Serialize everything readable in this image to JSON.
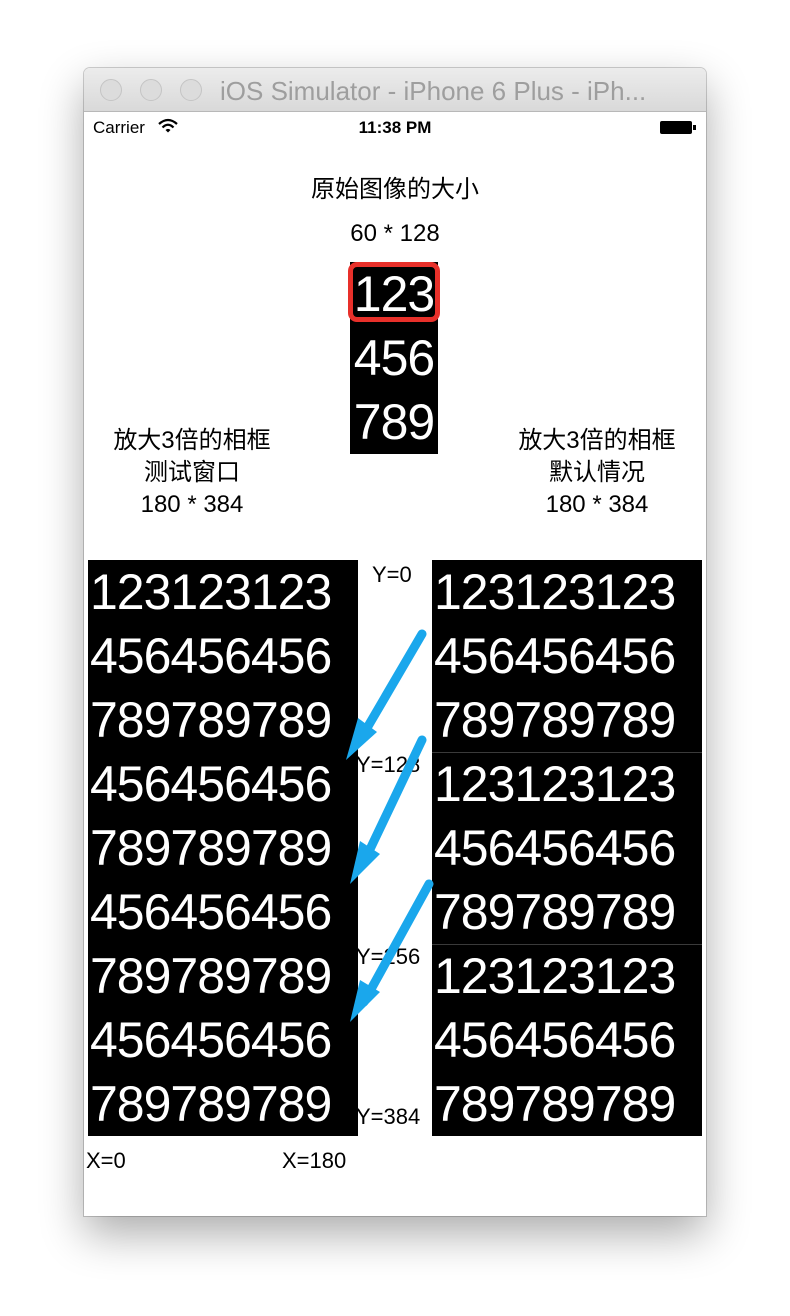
{
  "window": {
    "title": "iOS Simulator - iPhone 6 Plus - iPh..."
  },
  "statusbar": {
    "carrier": "Carrier",
    "time": "11:38 PM"
  },
  "original": {
    "title": "原始图像的大小",
    "size": "60 * 128",
    "rows": [
      "123",
      "456",
      "789"
    ]
  },
  "left_panel": {
    "line1": "放大3倍的相框",
    "line2": "测试窗口",
    "size": "180 * 384",
    "rows": [
      "123123123",
      "456456456",
      "789789789",
      "456456456",
      "789789789",
      "456456456",
      "789789789",
      "456456456",
      "789789789"
    ]
  },
  "right_panel": {
    "line1": "放大3倍的相框",
    "line2": "默认情况",
    "size": "180 * 384",
    "rows": [
      "123123123",
      "456456456",
      "789789789",
      "123123123",
      "456456456",
      "789789789",
      "123123123",
      "456456456",
      "789789789"
    ]
  },
  "y_labels": [
    "Y=0",
    "Y=128",
    "Y=256",
    "Y=384"
  ],
  "x_labels": [
    "X=0",
    "X=180"
  ],
  "colors": {
    "highlight": "#e8302a",
    "arrow": "#1aa7ec"
  }
}
